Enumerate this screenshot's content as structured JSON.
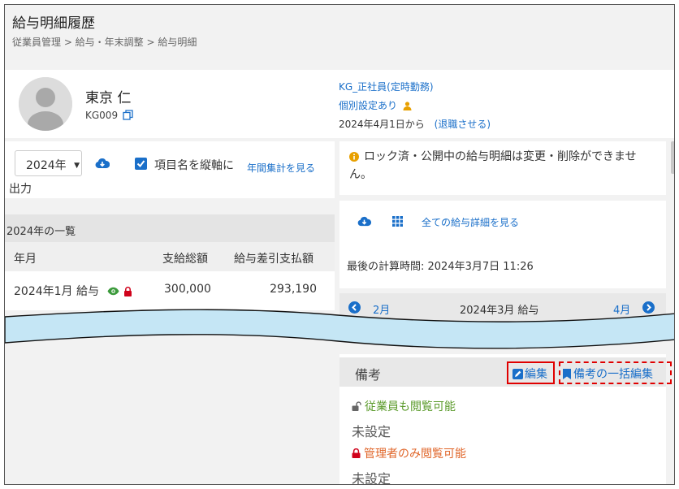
{
  "page": {
    "title": "給与明細履歴",
    "breadcrumb": "従業員管理 > 給与・年末調整 > 給与明細"
  },
  "employee": {
    "name": "東京 仁",
    "code": "KG009",
    "contract": "KG_正社員(定時勤務)",
    "individual_setting": "個別設定あり",
    "since": "2024年4月1日から",
    "retire_link": "(退職させる)"
  },
  "controls": {
    "year": "2024年",
    "vertical_label_line1": "項目名を縦軸に",
    "vertical_label_line2": "出力",
    "annual_link": "年間集計を見る"
  },
  "list": {
    "title": "2024年の一覧",
    "columns": [
      "年月",
      "支給総額",
      "給与差引支払額"
    ],
    "rows": [
      {
        "month": "2024年1月 給与",
        "gross": "300,000",
        "net": "293,190"
      }
    ]
  },
  "notice": {
    "text": "ロック済・公開中の給与明細は変更・削除ができません。"
  },
  "details": {
    "all_details_link": "全ての給与詳細を見る",
    "last_calc": "最後の計算時間: 2024年3月7日 11:26"
  },
  "month_nav": {
    "prev": "2月",
    "current": "2024年3月 給与",
    "next": "4月"
  },
  "notes": {
    "title": "備考",
    "edit_label": "編集",
    "bulk_edit_label": "備考の一括編集",
    "employee_visible_label": "従業員も閲覧可能",
    "employee_visible_value": "未設定",
    "admin_only_label": "管理者のみ閲覧可能",
    "admin_only_value": "未設定"
  },
  "colors": {
    "link": "#1a6fc9",
    "highlight": "#e00000",
    "employee_green": "#5a9a2a",
    "admin_orange": "#e0662a",
    "lock_red": "#d0021b",
    "break_band": "#c5e6f5"
  }
}
